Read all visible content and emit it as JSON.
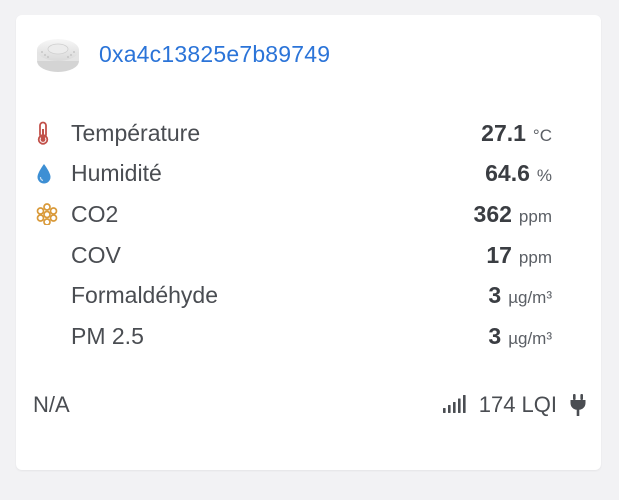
{
  "device": {
    "image_icon": "sensor-device-image",
    "id": "0xa4c13825e7b89749",
    "id_color": "#2b74d8"
  },
  "metrics": [
    {
      "icon": "thermometer-icon",
      "icon_color": "#c2514a",
      "label": "Température",
      "value": "27.1",
      "unit": "°C"
    },
    {
      "icon": "droplet-icon",
      "icon_color": "#3d8fd4",
      "label": "Humidité",
      "value": "64.6",
      "unit": "%"
    },
    {
      "icon": "molecule-icon",
      "icon_color": "#d99a3a",
      "label": "CO2",
      "value": "362",
      "unit": "ppm"
    },
    {
      "icon": "",
      "label": "COV",
      "value": "17",
      "unit": "ppm"
    },
    {
      "icon": "",
      "label": "Formaldéhyde",
      "value": "3",
      "unit": "µg/m³"
    },
    {
      "icon": "",
      "label": "PM 2.5",
      "value": "3",
      "unit": "µg/m³"
    }
  ],
  "footer": {
    "status": "N/A",
    "signal_icon": "signal-bars-icon",
    "lqi": "174 LQI",
    "power_icon": "plug-icon"
  }
}
